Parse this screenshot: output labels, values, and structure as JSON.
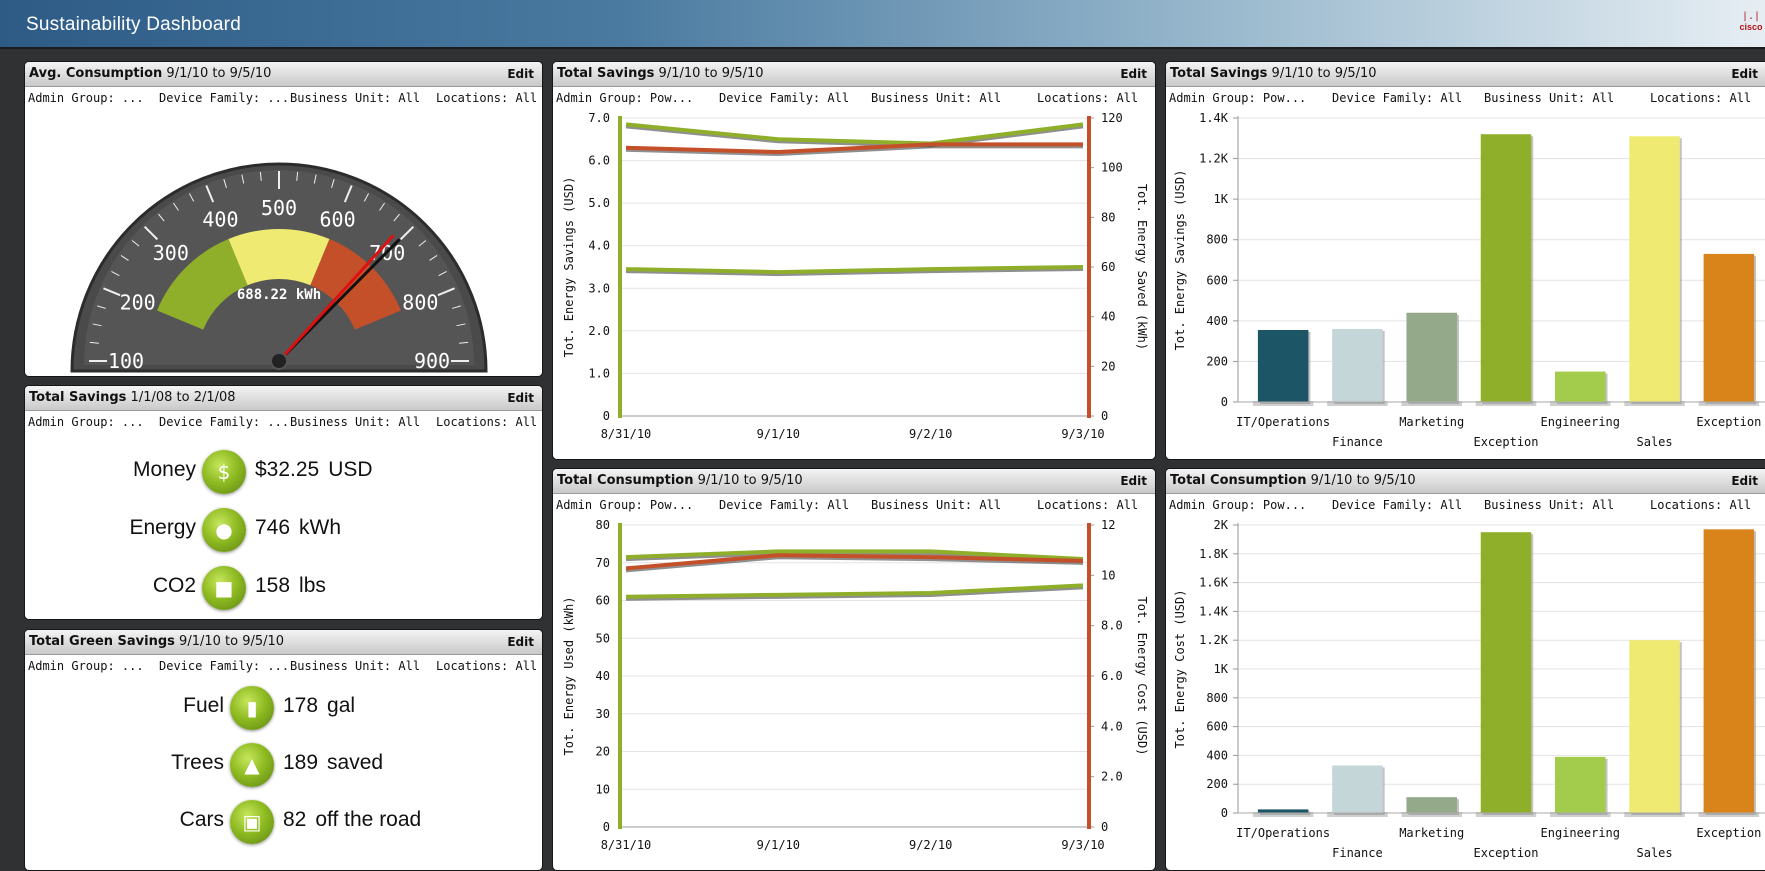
{
  "app": {
    "title": "Sustainability Dashboard",
    "brand": "cisco"
  },
  "filters_short": {
    "admin": "Admin Group: ...",
    "device": "Device Family: ...",
    "business": "Business Unit: All",
    "locations": "Locations: All"
  },
  "filters_long": {
    "admin": "Admin Group: Pow...",
    "device": "Device Family: All",
    "business": "Business Unit: All",
    "locations": "Locations: All"
  },
  "edit_label": "Edit",
  "panels": {
    "avg_consumption": {
      "title": "Avg. Consumption",
      "range": "9/1/10 to 9/5/10",
      "gauge": {
        "min": 100,
        "max": 900,
        "ticks": [
          "100",
          "200",
          "300",
          "400",
          "500",
          "600",
          "700",
          "800",
          "900"
        ],
        "value": 688.22,
        "readout": "688.22 kWh",
        "bands": [
          {
            "from": 200,
            "to": 400,
            "color": "#8fae2a"
          },
          {
            "from": 400,
            "to": 600,
            "color": "#eeea72"
          },
          {
            "from": 600,
            "to": 800,
            "color": "#c4502a"
          }
        ]
      }
    },
    "total_savings_money": {
      "title": "Total Savings",
      "range": "1/1/08 to 2/1/08",
      "rows": [
        {
          "label": "Money",
          "value": "$32.25",
          "unit": "USD",
          "icon": "money-icon"
        },
        {
          "label": "Energy",
          "value": "746",
          "unit": "kWh",
          "icon": "lightbulb-icon"
        },
        {
          "label": "CO2",
          "value": "158",
          "unit": "lbs",
          "icon": "factory-icon"
        }
      ]
    },
    "total_green_savings": {
      "title": "Total Green Savings",
      "range": "9/1/10 to 9/5/10",
      "rows": [
        {
          "label": "Fuel",
          "value": "178",
          "unit": "gal",
          "icon": "fuel-pump-icon"
        },
        {
          "label": "Trees",
          "value": "189",
          "unit": "saved",
          "icon": "tree-icon"
        },
        {
          "label": "Cars",
          "value": "82",
          "unit": "off the road",
          "icon": "car-icon"
        }
      ]
    },
    "savings_line": {
      "title": "Total Savings",
      "range": "9/1/10 to 9/5/10"
    },
    "consumption_line": {
      "title": "Total Consumption",
      "range": "9/1/10 to 9/5/10"
    },
    "savings_bar": {
      "title": "Total Savings",
      "range": "9/1/10 to 9/5/10"
    },
    "consumption_bar": {
      "title": "Total Consumption",
      "range": "9/1/10 to 9/5/10"
    }
  },
  "chart_data": [
    {
      "id": "savings_line",
      "type": "line",
      "x": [
        "8/31/10",
        "9/1/10",
        "9/2/10",
        "9/3/10"
      ],
      "ylabel": "Tot. Energy Savings (USD)",
      "ylim": [
        0,
        7.0
      ],
      "yticks": [
        "0",
        "1.0",
        "2.0",
        "3.0",
        "4.0",
        "5.0",
        "6.0",
        "7.0"
      ],
      "y2label": "Tot. Energy Saved (kWh)",
      "y2lim": [
        0,
        120
      ],
      "y2ticks": [
        "0",
        "20",
        "40",
        "60",
        "80",
        "100",
        "120"
      ],
      "grid": true,
      "left_axis_color": "#8fae2a",
      "right_axis_color": "#c4502a",
      "series": [
        {
          "axis": "left",
          "color": "#8fae2a",
          "values": [
            6.85,
            6.5,
            6.4,
            6.85
          ]
        },
        {
          "axis": "left",
          "color": "#c4502a",
          "values": [
            6.3,
            6.2,
            6.38,
            6.38
          ]
        },
        {
          "axis": "left",
          "color": "#8fae2a",
          "values": [
            3.45,
            3.38,
            3.45,
            3.5
          ]
        }
      ]
    },
    {
      "id": "consumption_line",
      "type": "line",
      "x": [
        "8/31/10",
        "9/1/10",
        "9/2/10",
        "9/3/10"
      ],
      "ylabel": "Tot. Energy Used (kWh)",
      "ylim": [
        0,
        80
      ],
      "yticks": [
        "0",
        "10",
        "20",
        "30",
        "40",
        "50",
        "60",
        "70",
        "80"
      ],
      "y2label": "Tot. Energy Cost (USD)",
      "y2lim": [
        0,
        12
      ],
      "y2ticks": [
        "0",
        "2.0",
        "4.0",
        "6.0",
        "8.0",
        "10",
        "12"
      ],
      "grid": true,
      "left_axis_color": "#8fae2a",
      "right_axis_color": "#c4502a",
      "series": [
        {
          "axis": "left",
          "color": "#8fae2a",
          "values": [
            71.5,
            73,
            73,
            71
          ]
        },
        {
          "axis": "left",
          "color": "#c4502a",
          "values": [
            68.5,
            72,
            71.5,
            70.5
          ]
        },
        {
          "axis": "left",
          "color": "#8fae2a",
          "values": [
            61,
            61.5,
            62,
            64
          ]
        }
      ]
    },
    {
      "id": "savings_bar",
      "type": "bar",
      "categories": [
        "IT/Operations",
        "Finance",
        "Marketing",
        "Exception",
        "Engineering",
        "Sales",
        "Exception"
      ],
      "values": [
        355,
        360,
        440,
        1320,
        150,
        1310,
        730
      ],
      "colors": [
        "#1c5566",
        "#c5d6d8",
        "#94a98a",
        "#8fae2a",
        "#a4cc4c",
        "#eeea72",
        "#d8841a"
      ],
      "ylabel": "Tot. Energy Savings (USD)",
      "ylim": [
        0,
        1400
      ],
      "yticks": [
        "0",
        "200",
        "400",
        "600",
        "800",
        "1K",
        "1.2K",
        "1.4K"
      ],
      "grid": true
    },
    {
      "id": "consumption_bar",
      "type": "bar",
      "categories": [
        "IT/Operations",
        "Finance",
        "Marketing",
        "Exception",
        "Engineering",
        "Sales",
        "Exception"
      ],
      "values": [
        25,
        330,
        110,
        1950,
        390,
        1200,
        1970
      ],
      "colors": [
        "#1c5566",
        "#c5d6d8",
        "#94a98a",
        "#8fae2a",
        "#a4cc4c",
        "#eeea72",
        "#d8841a"
      ],
      "ylabel": "Tot. Energy Cost (USD)",
      "ylim": [
        0,
        2000
      ],
      "yticks": [
        "0",
        "200",
        "400",
        "600",
        "800",
        "1K",
        "1.2K",
        "1.4K",
        "1.6K",
        "1.8K",
        "2K"
      ],
      "grid": true
    }
  ]
}
